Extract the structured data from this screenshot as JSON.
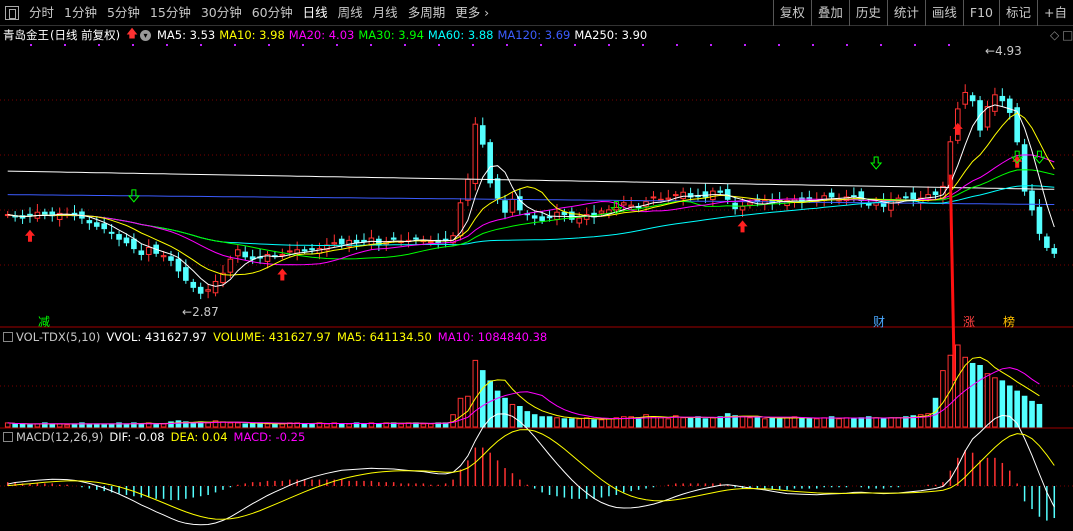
{
  "toolbar": {
    "periods": [
      "分时",
      "1分钟",
      "5分钟",
      "15分钟",
      "30分钟",
      "60分钟",
      "日线",
      "周线",
      "月线",
      "多周期",
      "更多"
    ],
    "active_period": "日线",
    "right_menu": [
      "复权",
      "叠加",
      "历史",
      "统计",
      "画线",
      "F10",
      "标记",
      "+自"
    ]
  },
  "main": {
    "stock_name": "青岛金王",
    "period_note": "(日线 前复权)",
    "ma_labels": [
      {
        "text": "MA5: 3.53",
        "color": "#ffffff"
      },
      {
        "text": "MA10: 3.98",
        "color": "#ffff00"
      },
      {
        "text": "MA20: 4.03",
        "color": "#ff00ff"
      },
      {
        "text": "MA30: 3.94",
        "color": "#00ff00"
      },
      {
        "text": "MA60: 3.88",
        "color": "#00ffff"
      },
      {
        "text": "MA120: 3.69",
        "color": "#3c5cff"
      },
      {
        "text": "MA250: 3.90",
        "color": "#ffffff"
      }
    ],
    "high_label": "4.93",
    "low_label": "2.87",
    "event_labels": [
      {
        "text": "减",
        "color": "#00ff00"
      },
      {
        "text": "财",
        "color": "#4aa8ff"
      },
      {
        "text": "涨",
        "color": "#ff4040"
      },
      {
        "text": "榜",
        "color": "#ffc000"
      }
    ]
  },
  "volume": {
    "title": "VOL-TDX(5,10)",
    "vvol": "VVOL: 431627.97",
    "volume": "VOLUME: 431627.97",
    "ma5": "MA5: 641134.50",
    "ma10": "MA10: 1084840.38"
  },
  "macd": {
    "title": "MACD(12,26,9)",
    "dif": "DIF: -0.08",
    "dea": "DEA: 0.04",
    "macd": "MACD: -0.25"
  },
  "colors": {
    "up": "#ff3232",
    "down": "#54ffff",
    "grid": "#7a0000",
    "ma5": "#ffffff",
    "ma10": "#ffff00",
    "ma20": "#ff00ff",
    "ma30": "#00ff00",
    "ma60": "#00ffff",
    "ma120": "#3c5cff",
    "ma250": "#ffffff"
  },
  "chart_data": {
    "type": "candlestick",
    "price_range": [
      2.75,
      5.05
    ],
    "close": [
      3.58,
      3.56,
      3.55,
      3.57,
      3.6,
      3.58,
      3.57,
      3.59,
      3.58,
      3.57,
      3.55,
      3.51,
      3.48,
      3.46,
      3.42,
      3.37,
      3.34,
      3.29,
      3.24,
      3.3,
      3.25,
      3.23,
      3.19,
      3.1,
      3.02,
      2.96,
      2.91,
      2.94,
      3.01,
      3.08,
      3.2,
      3.28,
      3.22,
      3.2,
      3.21,
      3.24,
      3.23,
      3.24,
      3.27,
      3.28,
      3.27,
      3.28,
      3.29,
      3.32,
      3.34,
      3.33,
      3.36,
      3.34,
      3.35,
      3.38,
      3.32,
      3.35,
      3.37,
      3.35,
      3.36,
      3.38,
      3.36,
      3.35,
      3.34,
      3.36,
      3.4,
      3.68,
      3.88,
      4.35,
      4.18,
      3.85,
      3.72,
      3.6,
      3.71,
      3.62,
      3.58,
      3.55,
      3.53,
      3.56,
      3.6,
      3.58,
      3.54,
      3.55,
      3.58,
      3.56,
      3.61,
      3.62,
      3.64,
      3.68,
      3.66,
      3.64,
      3.69,
      3.73,
      3.71,
      3.72,
      3.75,
      3.77,
      3.73,
      3.74,
      3.73,
      3.78,
      3.77,
      3.71,
      3.63,
      3.65,
      3.68,
      3.69,
      3.7,
      3.68,
      3.69,
      3.7,
      3.71,
      3.69,
      3.71,
      3.7,
      3.74,
      3.73,
      3.71,
      3.73,
      3.74,
      3.7,
      3.66,
      3.68,
      3.65,
      3.7,
      3.72,
      3.73,
      3.7,
      3.72,
      3.75,
      3.75,
      3.82,
      4.2,
      4.48,
      4.62,
      4.55,
      4.3,
      4.5,
      4.6,
      4.55,
      4.45,
      4.2,
      3.78,
      3.62,
      3.42,
      3.3,
      3.25
    ],
    "volume": [
      4,
      3,
      3,
      2,
      3,
      4,
      3,
      3,
      2,
      3,
      4,
      3,
      3,
      2,
      3,
      4,
      3,
      4,
      3,
      4,
      3,
      3,
      5,
      6,
      5,
      4,
      5,
      4,
      6,
      5,
      4,
      4,
      3,
      3,
      4,
      3,
      3,
      3,
      4,
      4,
      3,
      3,
      4,
      3,
      4,
      3,
      3,
      4,
      3,
      4,
      3,
      4,
      4,
      3,
      4,
      4,
      3,
      3,
      4,
      4,
      12,
      28,
      30,
      65,
      55,
      45,
      35,
      28,
      22,
      20,
      15,
      12,
      10,
      10,
      9,
      8,
      8,
      8,
      9,
      7,
      7,
      8,
      9,
      10,
      10,
      9,
      12,
      10,
      9,
      8,
      11,
      9,
      9,
      10,
      8,
      9,
      10,
      13,
      11,
      10,
      9,
      10,
      8,
      9,
      8,
      9,
      10,
      9,
      8,
      8,
      9,
      10,
      8,
      9,
      8,
      9,
      10,
      9,
      8,
      9,
      9,
      10,
      11,
      12,
      13,
      28,
      55,
      70,
      80,
      68,
      62,
      60,
      52,
      48,
      45,
      40,
      35,
      30,
      25,
      22
    ],
    "macd_hist": [
      0.03,
      0.03,
      0.02,
      0.02,
      0.02,
      0.02,
      0.02,
      0.01,
      0.01,
      0.0,
      -0.01,
      -0.02,
      -0.03,
      -0.04,
      -0.05,
      -0.06,
      -0.07,
      -0.08,
      -0.09,
      -0.09,
      -0.1,
      -0.1,
      -0.11,
      -0.11,
      -0.1,
      -0.09,
      -0.08,
      -0.07,
      -0.05,
      -0.03,
      -0.01,
      0.01,
      0.02,
      0.03,
      0.03,
      0.04,
      0.04,
      0.04,
      0.05,
      0.05,
      0.05,
      0.05,
      0.05,
      0.05,
      0.05,
      0.05,
      0.04,
      0.04,
      0.04,
      0.04,
      0.03,
      0.03,
      0.03,
      0.02,
      0.02,
      0.02,
      0.02,
      0.01,
      0.01,
      0.02,
      0.05,
      0.13,
      0.2,
      0.3,
      0.3,
      0.26,
      0.2,
      0.14,
      0.1,
      0.05,
      0.01,
      -0.02,
      -0.05,
      -0.07,
      -0.08,
      -0.09,
      -0.1,
      -0.1,
      -0.1,
      -0.1,
      -0.09,
      -0.08,
      -0.07,
      -0.05,
      -0.04,
      -0.03,
      -0.02,
      -0.01,
      0.0,
      0.01,
      0.02,
      0.02,
      0.02,
      0.02,
      0.02,
      0.02,
      0.02,
      0.01,
      -0.01,
      -0.02,
      -0.02,
      -0.02,
      -0.02,
      -0.03,
      -0.03,
      -0.03,
      -0.02,
      -0.02,
      -0.02,
      -0.02,
      -0.01,
      -0.01,
      -0.01,
      -0.01,
      0.0,
      -0.01,
      -0.02,
      -0.02,
      -0.02,
      -0.01,
      -0.01,
      0.0,
      0.0,
      0.0,
      0.01,
      0.01,
      0.03,
      0.12,
      0.22,
      0.28,
      0.26,
      0.2,
      0.22,
      0.22,
      0.18,
      0.12,
      0.02,
      -0.12,
      -0.18,
      -0.24,
      -0.27,
      -0.25
    ]
  }
}
